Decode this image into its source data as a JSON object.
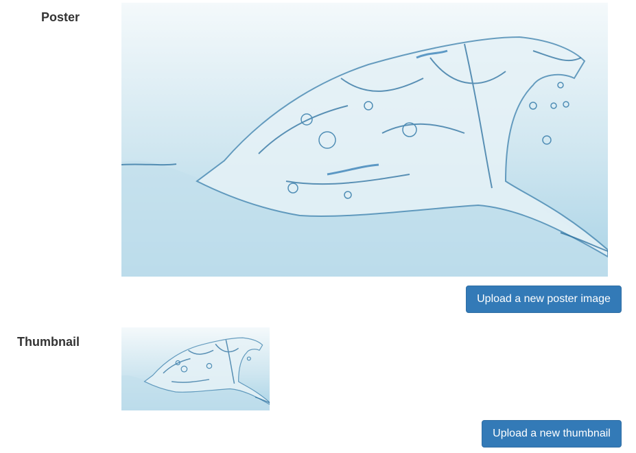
{
  "poster": {
    "label": "Poster",
    "image_icon": "water-splash-image",
    "upload_button_label": "Upload a new poster image"
  },
  "thumbnail": {
    "label": "Thumbnail",
    "image_icon": "water-splash-image",
    "upload_button_label": "Upload a new thumbnail"
  },
  "colors": {
    "primary_button": "#337ab7",
    "label_text": "#333333",
    "water_light": "#eef6f9",
    "water_dark": "#a9d3e6",
    "splash_stroke": "#2a6f9e"
  }
}
